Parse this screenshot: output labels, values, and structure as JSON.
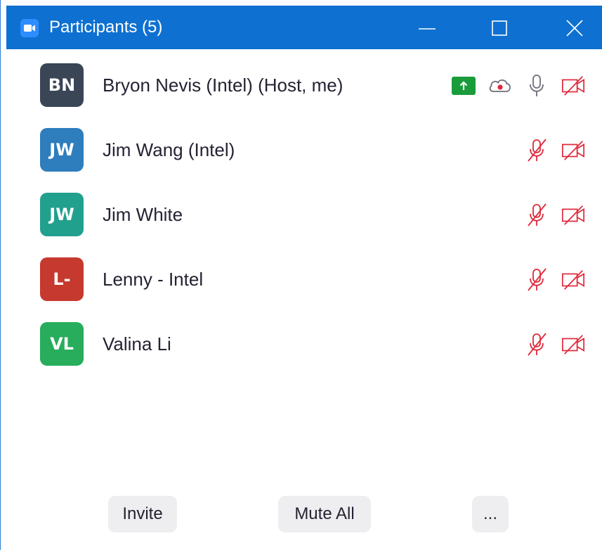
{
  "window": {
    "title": "Participants (5)"
  },
  "colors": {
    "titlebar": "#0e71d1",
    "muted_red": "#e0283b",
    "share_green": "#1a9c3b",
    "text": "#232333"
  },
  "participants": [
    {
      "initials": "BN",
      "name": "Bryon Nevis (Intel) (Host, me)",
      "avatar_color": "#3a4556",
      "icons": [
        "share-screen-icon",
        "cloud-record-icon",
        "microphone-icon",
        "video-off-icon"
      ]
    },
    {
      "initials": "JW",
      "name": "Jim Wang (Intel)",
      "avatar_color": "#2e7dbd",
      "icons": [
        "microphone-muted-icon",
        "video-off-icon"
      ]
    },
    {
      "initials": "JW",
      "name": "Jim White",
      "avatar_color": "#22a08e",
      "icons": [
        "microphone-muted-icon",
        "video-off-icon"
      ]
    },
    {
      "initials": "L-",
      "name": "Lenny - Intel",
      "avatar_color": "#c6392e",
      "icons": [
        "microphone-muted-icon",
        "video-off-icon"
      ]
    },
    {
      "initials": "VL",
      "name": "Valina Li",
      "avatar_color": "#27ad5c",
      "icons": [
        "microphone-muted-icon",
        "video-off-icon"
      ]
    }
  ],
  "footer": {
    "invite_label": "Invite",
    "mute_all_label": "Mute All",
    "more_label": "..."
  }
}
